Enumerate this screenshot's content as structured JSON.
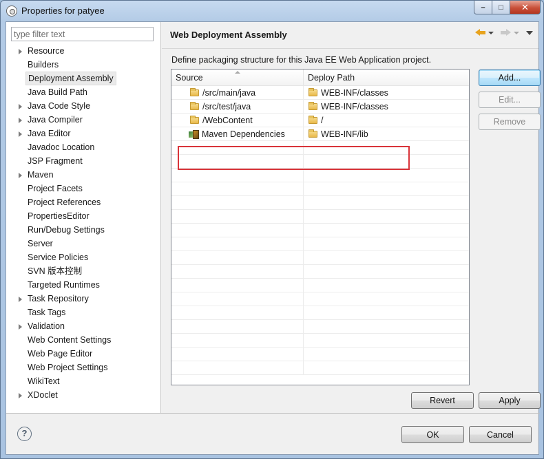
{
  "window": {
    "title": "Properties for patyee"
  },
  "caption": {
    "minimize": "–",
    "maximize": "□",
    "close": "✕"
  },
  "filter": {
    "placeholder": "type filter text",
    "value": ""
  },
  "nav": {
    "items": [
      {
        "label": "Resource",
        "expandable": true
      },
      {
        "label": "Builders",
        "expandable": false
      },
      {
        "label": "Deployment Assembly",
        "expandable": false,
        "selected": true
      },
      {
        "label": "Java Build Path",
        "expandable": false
      },
      {
        "label": "Java Code Style",
        "expandable": true
      },
      {
        "label": "Java Compiler",
        "expandable": true
      },
      {
        "label": "Java Editor",
        "expandable": true
      },
      {
        "label": "Javadoc Location",
        "expandable": false
      },
      {
        "label": "JSP Fragment",
        "expandable": false
      },
      {
        "label": "Maven",
        "expandable": true
      },
      {
        "label": "Project Facets",
        "expandable": false
      },
      {
        "label": "Project References",
        "expandable": false
      },
      {
        "label": "PropertiesEditor",
        "expandable": false
      },
      {
        "label": "Run/Debug Settings",
        "expandable": false
      },
      {
        "label": "Server",
        "expandable": false
      },
      {
        "label": "Service Policies",
        "expandable": false
      },
      {
        "label": "SVN 版本控制",
        "expandable": false
      },
      {
        "label": "Targeted Runtimes",
        "expandable": false
      },
      {
        "label": "Task Repository",
        "expandable": true
      },
      {
        "label": "Task Tags",
        "expandable": false
      },
      {
        "label": "Validation",
        "expandable": true
      },
      {
        "label": "Web Content Settings",
        "expandable": false
      },
      {
        "label": "Web Page Editor",
        "expandable": false
      },
      {
        "label": "Web Project Settings",
        "expandable": false
      },
      {
        "label": "WikiText",
        "expandable": false
      },
      {
        "label": "XDoclet",
        "expandable": true
      }
    ]
  },
  "page": {
    "title": "Web Deployment Assembly",
    "description": "Define packaging structure for this Java EE Web Application project.",
    "table": {
      "columns": [
        "Source",
        "Deploy Path"
      ],
      "rows": [
        {
          "source": "/src/main/java",
          "deploy": "WEB-INF/classes",
          "icon": "folder-icon"
        },
        {
          "source": "/src/test/java",
          "deploy": "WEB-INF/classes",
          "icon": "folder-icon"
        },
        {
          "source": "/WebContent",
          "deploy": "/",
          "icon": "folder-icon"
        },
        {
          "source": "Maven Dependencies",
          "deploy": "WEB-INF/lib",
          "icon": "maven-library-icon"
        }
      ],
      "empty_rows": 17
    },
    "buttons": {
      "add": "Add...",
      "edit": "Edit...",
      "remove": "Remove",
      "revert": "Revert",
      "apply": "Apply"
    }
  },
  "footer": {
    "help": "?",
    "ok": "OK",
    "cancel": "Cancel"
  },
  "colors": {
    "highlight_box": "#d9343a",
    "back_arrow": "#e8a31d"
  }
}
